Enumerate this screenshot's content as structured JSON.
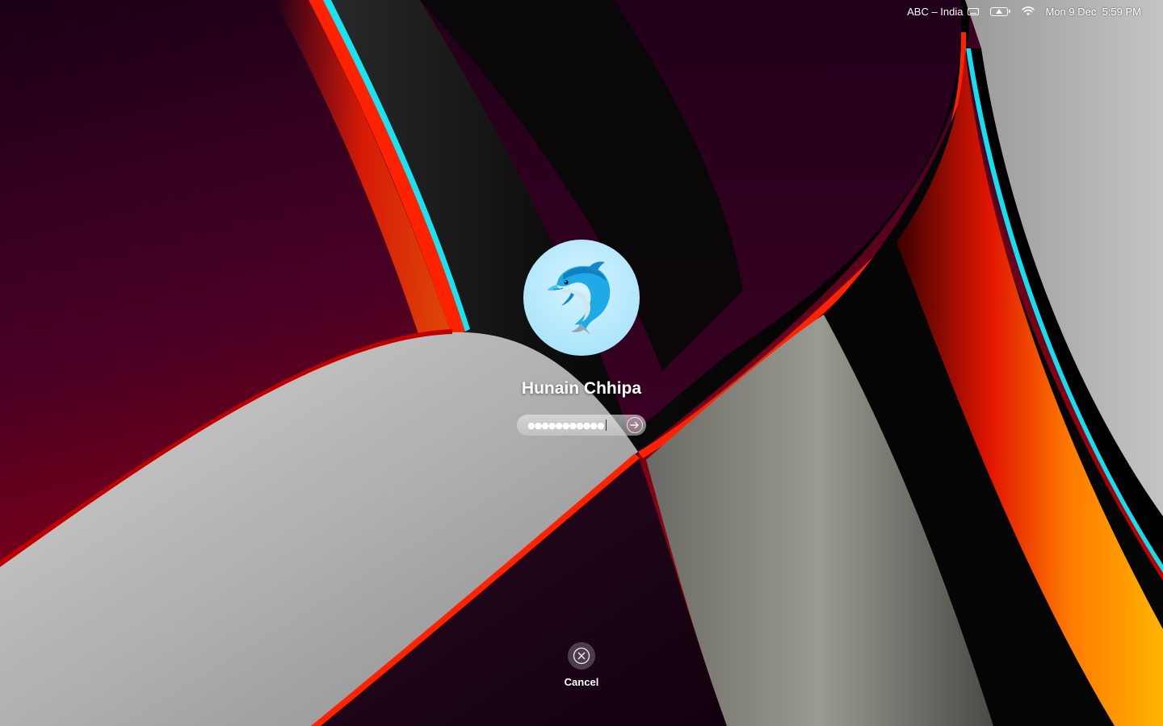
{
  "menubar": {
    "input_source": "ABC – India",
    "date_time": "Mon 9 Dec  5:59 PM",
    "keyboard_icon": "keyboard-icon",
    "battery_icon": "battery-warning-icon",
    "wifi_icon": "wifi-icon"
  },
  "login": {
    "avatar_icon": "dolphin-icon",
    "user_name": "Hunain Chhipa",
    "password_masked": "●●●●●●●●●●●",
    "submit_icon": "arrow-right-circle-icon"
  },
  "cancel": {
    "icon": "close-circle-icon",
    "label": "Cancel"
  },
  "colors": {
    "accent_red": "#e2231a",
    "accent_orange": "#ff8a00",
    "accent_cyan": "#11e0f0",
    "avatar_bg": "#aee6fb"
  }
}
